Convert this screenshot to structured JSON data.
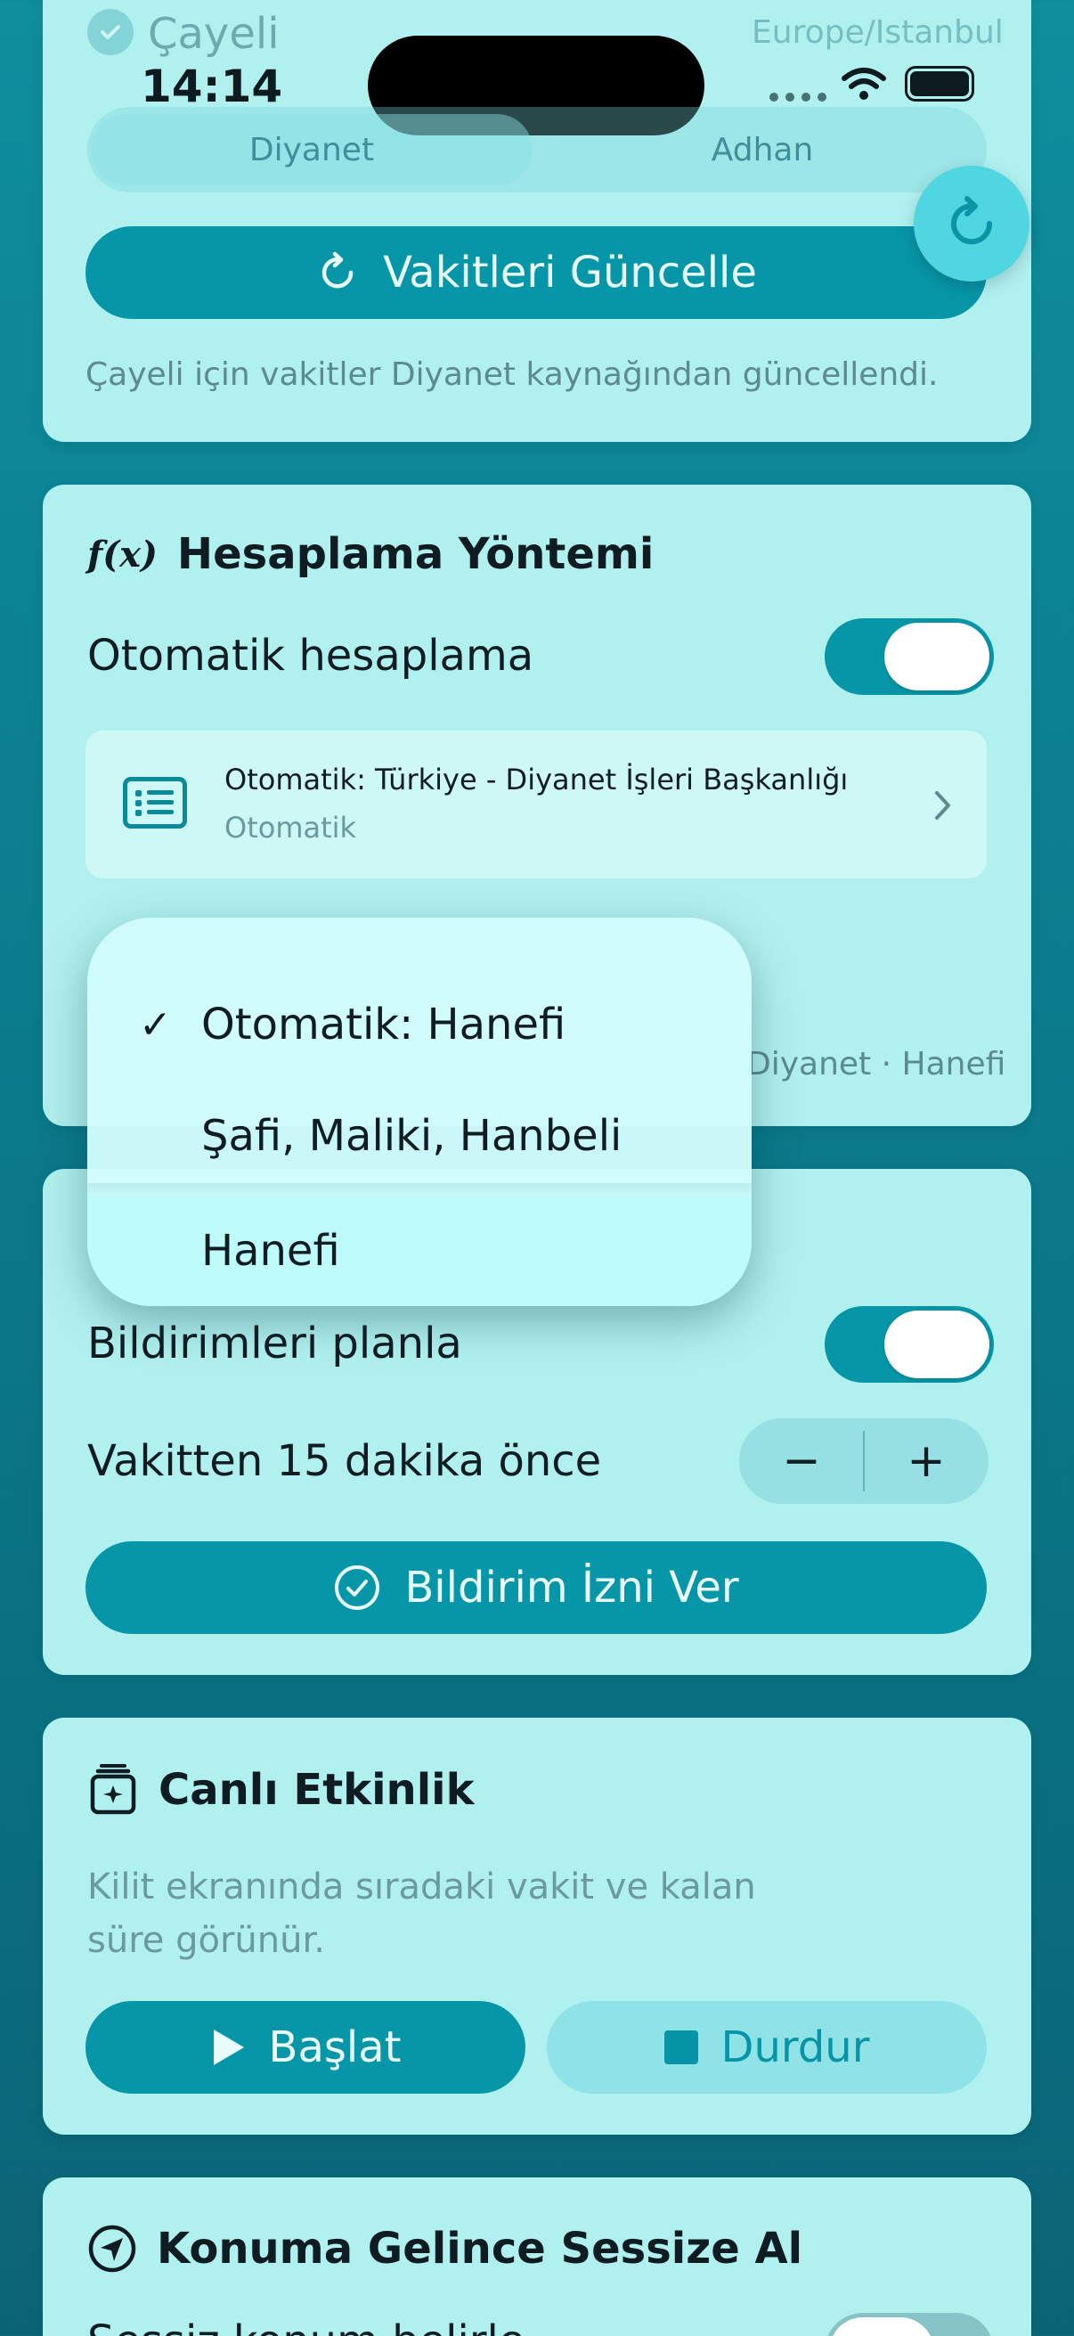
{
  "status_bar": {
    "time": "14:14"
  },
  "location_card": {
    "city": "Çayeli",
    "timezone": "Europe/Istanbul",
    "segments": [
      "Diyanet",
      "Adhan"
    ],
    "selected_segment": "Diyanet",
    "update_button": "Vakitleri Güncelle",
    "update_message": "Çayeli için vakitler Diyanet kaynağından güncellendi."
  },
  "calc_card": {
    "title": "Hesaplama Yöntemi",
    "title_icon": "f(x)",
    "auto_label": "Otomatik hesaplama",
    "auto_on": true,
    "method_title": "Otomatik: Türkiye - Diyanet İşleri Başkanlığı",
    "method_subtitle": "Otomatik",
    "footer_text": "Diyanet · Hanefi"
  },
  "madhab_menu": {
    "items": [
      "Otomatik: Hanefi",
      "Şafi, Maliki, Hanbeli",
      "Hanefi"
    ],
    "selected_index": 0
  },
  "notif_card": {
    "schedule_label": "Bildirimleri planla",
    "schedule_on": true,
    "offset_label": "Vakitten 15 dakika önce",
    "stepper_minus": "−",
    "stepper_plus": "+",
    "permission_button": "Bildirim İzni Ver"
  },
  "live_card": {
    "title": "Canlı Etkinlik",
    "description_line1": "Kilit ekranında sıradaki vakit ve kalan",
    "description_line2": "süre görünür.",
    "start_button": "Başlat",
    "stop_button": "Durdur"
  },
  "silent_card": {
    "title": "Konuma Gelince Sessize Al",
    "partial_label": "Sessiz konum belirle"
  },
  "colors": {
    "accent": "#0796a8",
    "card": "#b0f1f0",
    "background": "#0b7d8e"
  }
}
